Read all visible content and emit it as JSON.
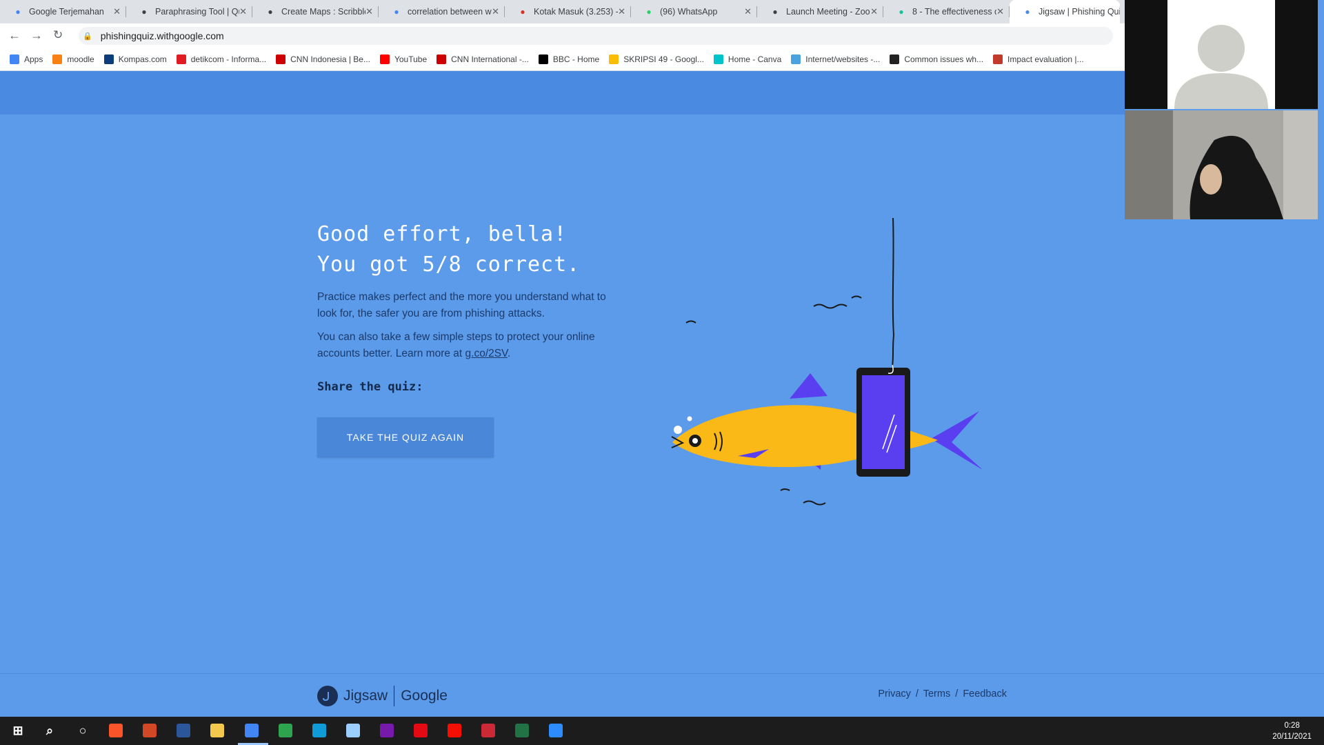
{
  "browser": {
    "tabs": [
      {
        "title": "Google Terjemahan",
        "icon": "google-translate-icon",
        "color": "#4285f4"
      },
      {
        "title": "Paraphrasing Tool | Qu",
        "icon": "quillbot-icon",
        "color": "#3c4043"
      },
      {
        "title": "Create Maps : Scribble",
        "icon": "scribble-maps-icon",
        "color": "#3c4043"
      },
      {
        "title": "correlation between w",
        "icon": "scholar-icon",
        "color": "#4285f4"
      },
      {
        "title": "Kotak Masuk (3.253) -",
        "icon": "gmail-icon",
        "color": "#d93025"
      },
      {
        "title": "(96) WhatsApp",
        "icon": "whatsapp-icon",
        "color": "#25d366"
      },
      {
        "title": "Launch Meeting - Zoo",
        "icon": "globe-icon",
        "color": "#3c4043"
      },
      {
        "title": "8 - The effectiveness o",
        "icon": "grammarly-icon",
        "color": "#15c39a"
      },
      {
        "title": "Jigsaw | Phishing Quiz",
        "icon": "jigsaw-tab-icon",
        "color": "#4a8ae0"
      }
    ],
    "url": "phishingquiz.withgoogle.com",
    "bookmarks": [
      {
        "label": "Apps",
        "icon": "apps-grid-icon",
        "color": "#4285f4"
      },
      {
        "label": "moodle",
        "icon": "moodle-icon",
        "color": "#f98012"
      },
      {
        "label": "Kompas.com",
        "icon": "kompas-icon",
        "color": "#0c3c7a"
      },
      {
        "label": "detikcom - Informa...",
        "icon": "detik-icon",
        "color": "#e01b22"
      },
      {
        "label": "CNN Indonesia | Be...",
        "icon": "cnn-icon",
        "color": "#cc0000"
      },
      {
        "label": "YouTube",
        "icon": "youtube-icon",
        "color": "#ff0000"
      },
      {
        "label": "CNN International -...",
        "icon": "cnn-icon",
        "color": "#cc0000"
      },
      {
        "label": "BBC - Home",
        "icon": "bbc-icon",
        "color": "#000000"
      },
      {
        "label": "SKRIPSI 49 - Googl...",
        "icon": "google-drive-icon",
        "color": "#fbbc04"
      },
      {
        "label": "Home - Canva",
        "icon": "canva-icon",
        "color": "#00c4cc"
      },
      {
        "label": "Internet/websites -...",
        "icon": "cloud-icon",
        "color": "#4aa3df"
      },
      {
        "label": "Common issues wh...",
        "icon": "doc-icon",
        "color": "#222222"
      },
      {
        "label": "Impact evaluation |...",
        "icon": "impact-icon",
        "color": "#c0392b"
      }
    ]
  },
  "quiz": {
    "heading_line1": "Good effort, bella!",
    "heading_line2": "You got 5/8 correct.",
    "para1": "Practice makes perfect and the more you understand what to look for, the safer you are from phishing attacks.",
    "para2_prefix": "You can also take a few simple steps to protect your online accounts better. Learn more at ",
    "para2_link": "g.co/2SV",
    "para2_suffix": ".",
    "share_label": "Share the quiz:",
    "retake_label": "TAKE THE QUIZ AGAIN",
    "score_correct": 5,
    "score_total": 8
  },
  "footer": {
    "brand1": "Jigsaw",
    "brand2": "Google",
    "links": [
      "Privacy",
      "Terms",
      "Feedback"
    ],
    "separator": "/"
  },
  "taskbar": {
    "time": "0:28",
    "date": "20/11/2021",
    "apps": [
      {
        "name": "start-icon",
        "color": "#ffffff"
      },
      {
        "name": "search-icon",
        "color": "#ffffff"
      },
      {
        "name": "cortana-icon",
        "color": "#ffffff"
      },
      {
        "name": "brave-icon",
        "color": "#fb542b"
      },
      {
        "name": "powerpoint-icon",
        "color": "#d24726"
      },
      {
        "name": "word-icon",
        "color": "#2b579a"
      },
      {
        "name": "file-explorer-icon",
        "color": "#f2c94c"
      },
      {
        "name": "chrome-icon",
        "color": "#4285f4"
      },
      {
        "name": "edge-beta-icon",
        "color": "#2ea44f"
      },
      {
        "name": "edge-icon",
        "color": "#0f9bd7"
      },
      {
        "name": "store-icon",
        "color": "#9ccfff"
      },
      {
        "name": "onenote-icon",
        "color": "#7719aa"
      },
      {
        "name": "netflix-icon",
        "color": "#e50914"
      },
      {
        "name": "acrobat-icon",
        "color": "#f40f02"
      },
      {
        "name": "zotero-icon",
        "color": "#cc2936"
      },
      {
        "name": "excel-icon",
        "color": "#217346"
      },
      {
        "name": "zoom-icon",
        "color": "#2d8cff"
      }
    ]
  },
  "colors": {
    "page_bg": "#5b9be9",
    "header_bg": "#4a8ae0",
    "fish_body": "#fbb917",
    "fish_fin": "#5a3ff0",
    "button_bg": "#4a87d9"
  }
}
